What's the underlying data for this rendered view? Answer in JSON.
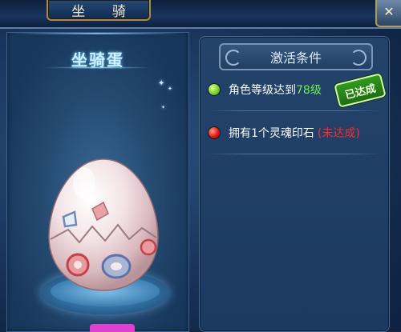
{
  "window": {
    "title": "坐  骑",
    "close_glyph": "✕"
  },
  "mount": {
    "name": "坐骑蛋"
  },
  "conditions_panel": {
    "header": "激活条件",
    "items": [
      {
        "text_before": "角色等级达到",
        "level": "78级",
        "status": "met",
        "badge": "已达成"
      },
      {
        "text": "拥有1个灵魂印石",
        "status": "not_met",
        "status_text": "(未达成)"
      }
    ]
  },
  "icons": {
    "met": "green-circle-icon",
    "not_met": "red-circle-icon"
  },
  "colors": {
    "met_green": "#6cf04a",
    "not_met_red": "#ff2a2a",
    "panel_bg": "#1c3a60"
  }
}
